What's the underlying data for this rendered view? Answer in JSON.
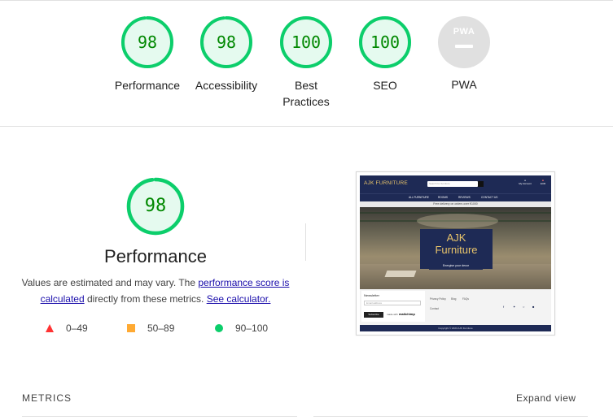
{
  "summary_gauges": [
    {
      "score": "98",
      "label": "Performance",
      "value": 0.98
    },
    {
      "score": "98",
      "label": "Accessibility",
      "value": 0.98
    },
    {
      "score": "100",
      "label": "Best Practices",
      "value": 1.0
    },
    {
      "score": "100",
      "label": "SEO",
      "value": 1.0
    },
    {
      "score": "",
      "label": "PWA",
      "badge": "PWA"
    }
  ],
  "performance": {
    "score": "98",
    "value": 0.98,
    "title": "Performance",
    "desc_prefix": "Values are estimated and may vary. The ",
    "desc_link1": "performance score is calculated",
    "desc_middle": " directly from these metrics. ",
    "desc_link2": "See calculator."
  },
  "legend": [
    {
      "icon": "red-triangle-icon",
      "range": "0–49",
      "color": "#ff3333"
    },
    {
      "icon": "orange-square-icon",
      "range": "50–89",
      "color": "#ffaa33"
    },
    {
      "icon": "green-circle-icon",
      "range": "90–100",
      "color": "#0cce6b"
    }
  ],
  "colors": {
    "pass": "#0cce6b",
    "pass_text": "#008800",
    "pass_bg": "#e5faef",
    "pwa_grey": "#e0e0e0"
  },
  "screenshot": {
    "logo": "AJK FURNITURE",
    "search_placeholder": "Search for furniture",
    "account": "My Account",
    "flag": "EUR",
    "nav": [
      "ALL FURNITURE",
      "ROOMS",
      "REVIEWS",
      "CONTACT US"
    ],
    "banner": "Free delivery on orders over €1000",
    "hero_line1": "AJK",
    "hero_line2": "Furniture",
    "hero_button": "Energise your decor",
    "newsletter_title": "Newsletter",
    "newsletter_placeholder": "Email address",
    "subscribe": "Subscribe",
    "made_with": "made with",
    "mailchimp": "mailchimp",
    "footer_links": [
      "Privacy Policy",
      "Blog",
      "FAQs",
      "Contact"
    ],
    "copyright": "Copyright © 2023 AJK Furniture"
  },
  "metrics": {
    "label": "METRICS",
    "expand": "Expand view"
  }
}
